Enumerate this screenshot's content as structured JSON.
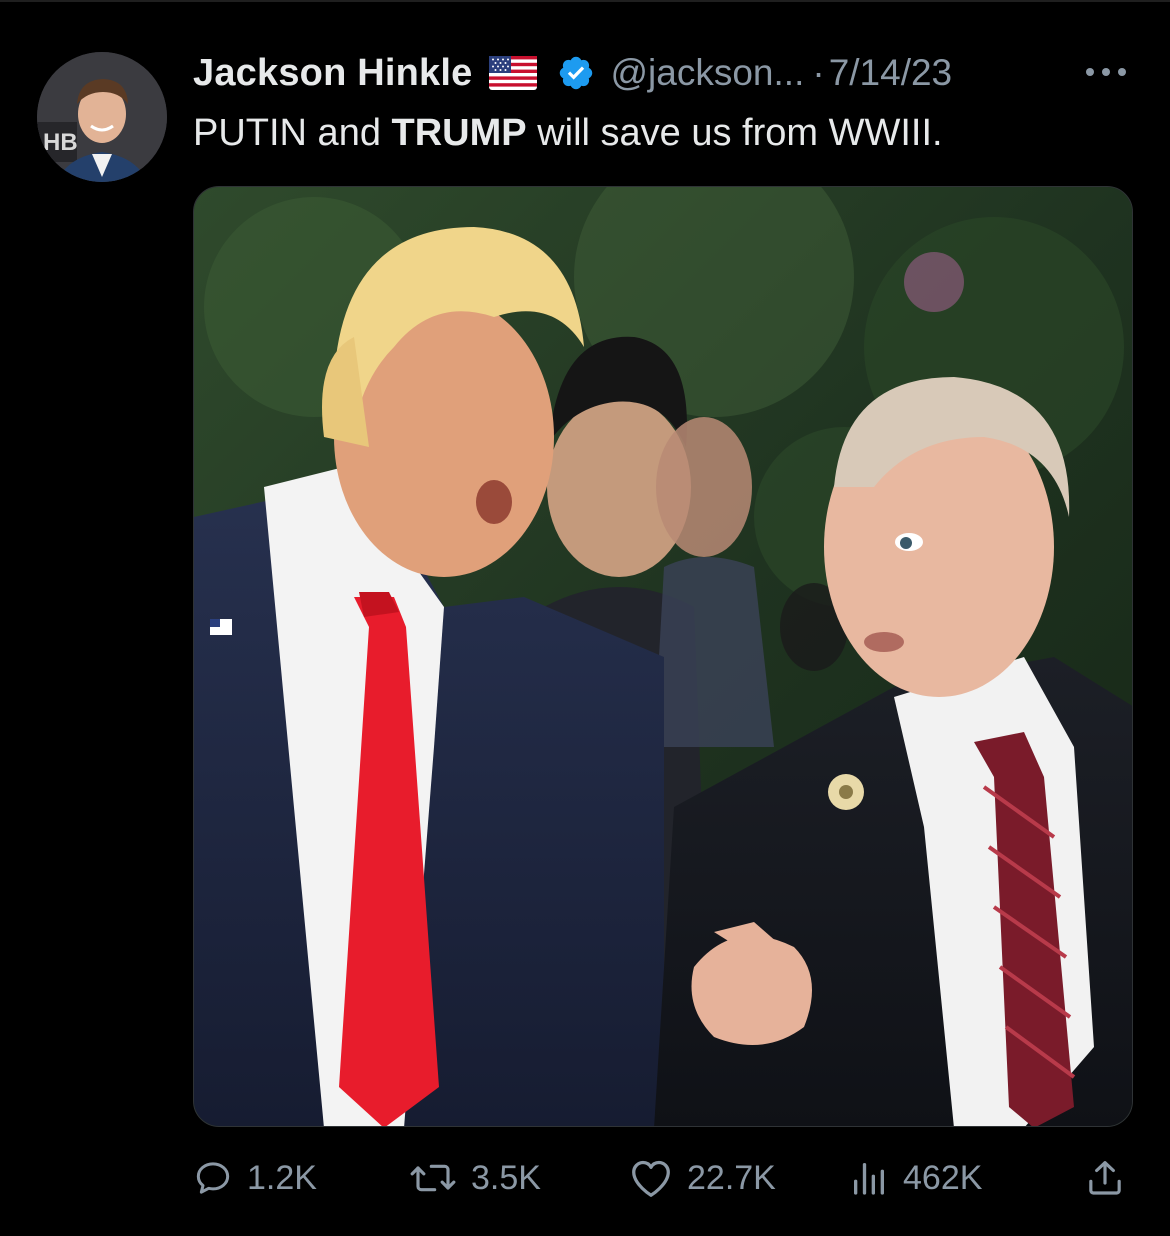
{
  "tweet": {
    "display_name": "Jackson Hinkle",
    "flag_emoji_icon": "us-flag-icon",
    "verified_icon": "verified-badge-icon",
    "handle": "@jackson...",
    "separator": "·",
    "date": "7/14/23",
    "text_parts": {
      "part1": "PUTIN",
      "part2": " and ",
      "part3": "TRUMP",
      "part4": " will save us from WWIII."
    },
    "media": {
      "alt": "Photo of two men in suits talking outdoors",
      "avatar_logo_text": "HB"
    }
  },
  "actions": {
    "reply": {
      "icon": "reply-icon",
      "count": "1.2K"
    },
    "retweet": {
      "icon": "retweet-icon",
      "count": "3.5K"
    },
    "like": {
      "icon": "heart-icon",
      "count": "22.7K"
    },
    "views": {
      "icon": "views-icon",
      "count": "462K"
    },
    "share": {
      "icon": "share-icon"
    }
  },
  "colors": {
    "background": "#000000",
    "text_primary": "#e7e9ea",
    "text_secondary": "#8b98a5",
    "verified_blue": "#1d9bf0"
  }
}
